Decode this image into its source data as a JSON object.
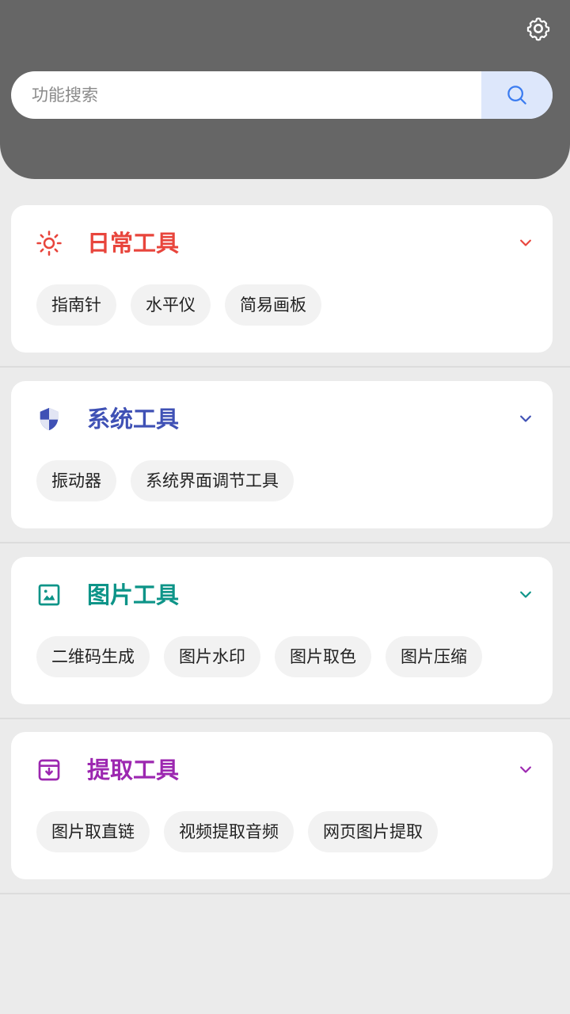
{
  "header": {
    "settings_icon": "gear-icon",
    "search": {
      "placeholder": "功能搜索",
      "value": "",
      "button_icon": "search-icon"
    }
  },
  "sections": [
    {
      "title": "日常工具",
      "color": "#e8453c",
      "icon": "sun-icon",
      "items": [
        "指南针",
        "水平仪",
        "简易画板"
      ]
    },
    {
      "title": "系统工具",
      "color": "#3f51b5",
      "icon": "shield-icon",
      "items": [
        "振动器",
        "系统界面调节工具"
      ]
    },
    {
      "title": "图片工具",
      "color": "#0d9488",
      "icon": "image-icon",
      "items": [
        "二维码生成",
        "图片水印",
        "图片取色",
        "图片压缩"
      ]
    },
    {
      "title": "提取工具",
      "color": "#9c27b0",
      "icon": "archive-icon",
      "items": [
        "图片取直链",
        "视频提取音频",
        "网页图片提取"
      ]
    }
  ]
}
